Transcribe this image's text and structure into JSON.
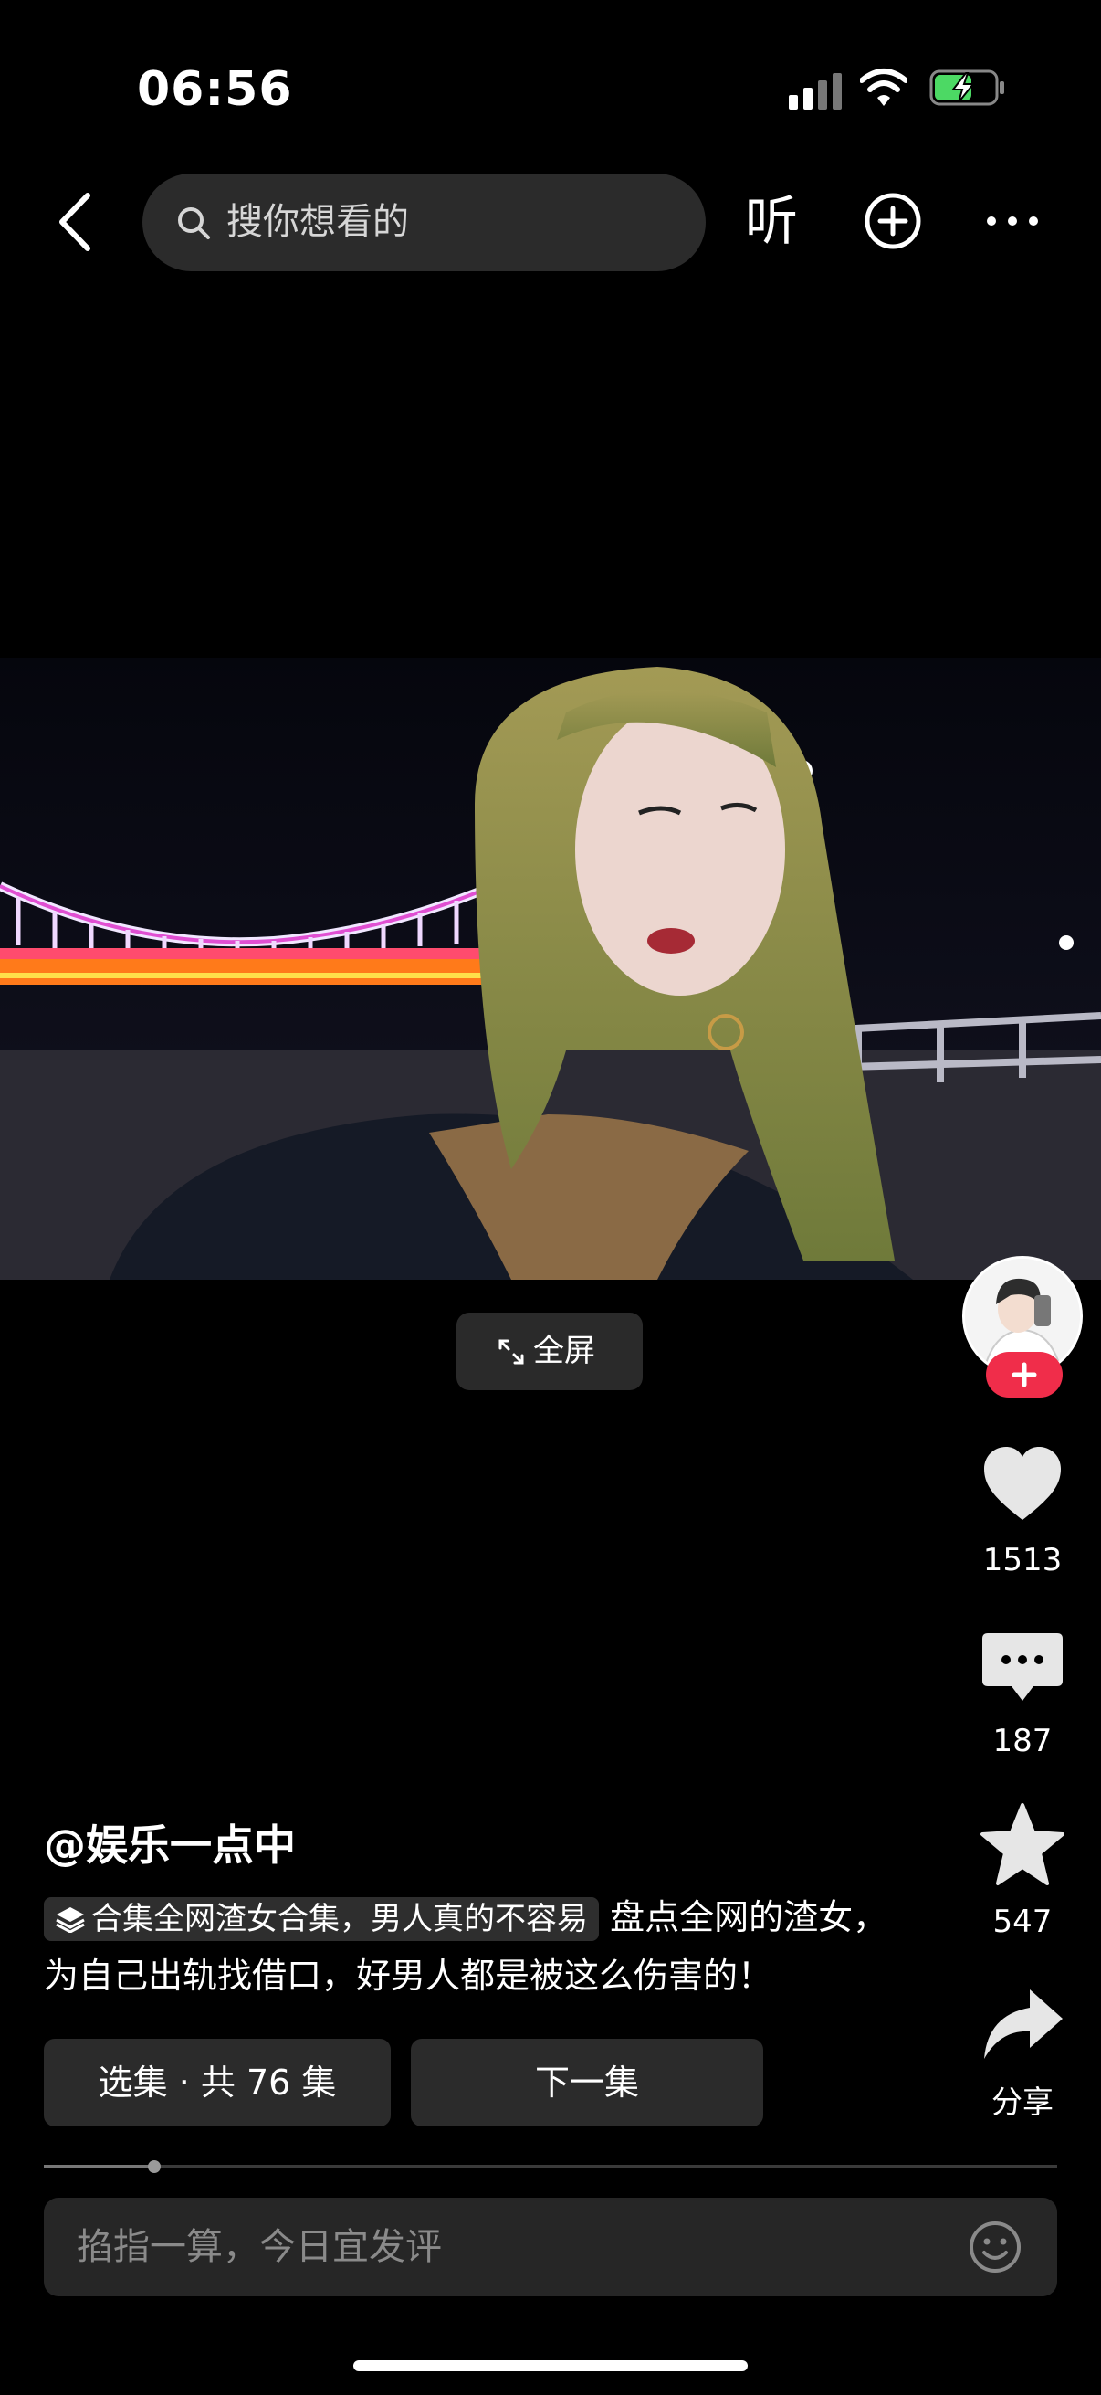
{
  "status_bar": {
    "time": "06:56"
  },
  "top_bar": {
    "search_placeholder": "搜你想看的",
    "listen_label": "听"
  },
  "video": {
    "fullscreen_label": "全屏"
  },
  "actions": {
    "likes": "1513",
    "comments": "187",
    "favorites": "547",
    "share_label": "分享"
  },
  "post": {
    "author": "@娱乐一点中",
    "collection_tag": "合集全网渣女合集，男人真的不容易",
    "caption": "盘点全网的渣女，为自己出轨找借口，好男人都是被这么伤害的！"
  },
  "buttons": {
    "episodes": "选集 · 共 76 集",
    "next": "下一集"
  },
  "comment_box": {
    "placeholder": "掐指一算，今日宜发评"
  },
  "colors": {
    "follow_red": "#f02d4a",
    "battery_green": "#4cd964"
  }
}
